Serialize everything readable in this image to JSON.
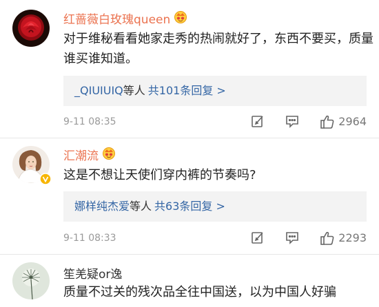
{
  "comments": [
    {
      "username": "红蔷薇白玫瑰queen",
      "text": "对于维秘看看她家走秀的热闹就好了，东西不要买，质量谁买谁知道。",
      "reply_user": "_QIUIUIQ",
      "reply_suffix": "等人",
      "reply_count": "共101条回复 >",
      "time": "9-11 08:35",
      "likes": "2964"
    },
    {
      "username": "汇潮流",
      "text": "这是不想让天使们穿内裤的节奏吗?",
      "reply_user": "娜样纯杰爱",
      "reply_suffix": "等人",
      "reply_count": "共63条回复 >",
      "time": "9-11 08:33",
      "likes": "2293"
    },
    {
      "username": "笙羌疑or逸",
      "text": "质量不过关的残次品全往中国送，以为中国人好骗"
    }
  ]
}
